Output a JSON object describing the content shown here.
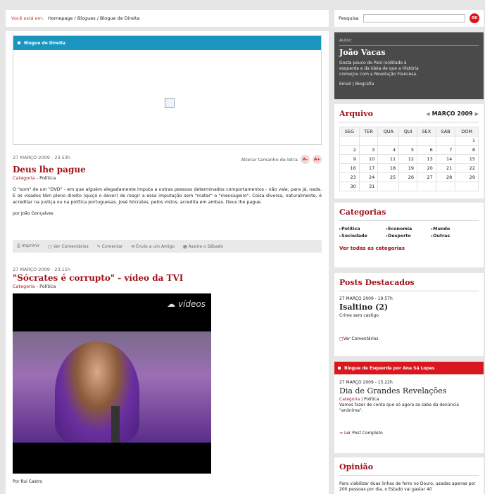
{
  "breadcrumb": {
    "label": "Você está em:",
    "path": "Homepage / Blogues / Blogue de Direita"
  },
  "search": {
    "label": "Pesquisa",
    "placeholder": "",
    "button": "OK"
  },
  "embed": {
    "title": "Blogue de Direita"
  },
  "post1": {
    "date": "27 MARÇO 2009 - 23.53h",
    "title": "Deus lhe pague",
    "category_label": "Categoria",
    "category": "Política",
    "font_size_label": "Alterar tamanho de letra",
    "font_minus": "A-",
    "font_plus": "A+",
    "body": "O \"som\" de um \"DVD\" - em que alguém alegadamente imputa a outras pessoas determinados comportamentos - não vale, para já, nada. E os visados têm pleno direito (quiçá o dever) de reagir a essa imputação sem \"matar\" o \"mensageiro\". Coisa diversa, naturalmente, é acreditar na justiça ou na política portuguesas. José Sócrates, pelos vistos, acredita em ambas. Deus lhe pague.",
    "author": "por João Gonçalves",
    "actions": [
      "Imprimir",
      "Ver Comentários",
      "Comentar",
      "Envie a um Amigo",
      "Assine o Sábado"
    ]
  },
  "post2": {
    "date": "27 MARÇO 2009 - 23.11h",
    "title": "\"Sócrates é corrupto\" - vídeo da TVI",
    "category_label": "Categoria",
    "category": "Política",
    "video_logo": "vídeos",
    "author": "Por Rui Castro"
  },
  "author_box": {
    "label": "Autor:",
    "name": "João Vacas",
    "description": "Gosta pouco do País (e)ditado à esquerda e da ideia de que a História começou com a Revolução Francesa.",
    "links": "Email | Biografia"
  },
  "archive": {
    "title": "Arquivo",
    "month": "MARÇO 2009",
    "days": [
      "SEG",
      "TER",
      "QUA",
      "QUI",
      "SEX",
      "SÁB",
      "DOM"
    ],
    "weeks": [
      [
        "",
        "",
        "",
        "",
        "",
        "",
        "1"
      ],
      [
        "2",
        "3",
        "4",
        "5",
        "6",
        "7",
        "8"
      ],
      [
        "9",
        "10",
        "11",
        "12",
        "13",
        "14",
        "15"
      ],
      [
        "16",
        "17",
        "18",
        "19",
        "20",
        "21",
        "22"
      ],
      [
        "23",
        "24",
        "25",
        "26",
        "27",
        "28",
        "29"
      ],
      [
        "30",
        "31",
        "",
        "",
        "",
        "",
        ""
      ]
    ]
  },
  "categories": {
    "title": "Categorias",
    "items": [
      "Política",
      "Economia",
      "Mundo",
      "Sociedade",
      "Desporto",
      "Outras"
    ],
    "all": "Ver todas as categorias"
  },
  "featured": {
    "title": "Posts Destacados",
    "date": "27 MARÇO 2009 - 19.57h",
    "post_title": "Isaltino (2)",
    "subtitle": "Crime sem castigo",
    "link": "Ver Comentários"
  },
  "left_blog": {
    "bar": "Blogue de Esquerda por Ana Sá Lopes",
    "date": "27 MARÇO 2009 - 15.22h",
    "title": "Dia de Grandes Revelações",
    "category_label": "Categoria",
    "category": "Política",
    "text": "Vamos fazer de conta que só agora se sabe da denúncia \"anónima\".",
    "link": "Ler Post Completo"
  },
  "opinion": {
    "title": "Opinião",
    "text": "Para viabilizar duas linhas de ferro no Douro, usadas apenas por 200 pessoas por dia, o Estado vai gastar 40"
  }
}
